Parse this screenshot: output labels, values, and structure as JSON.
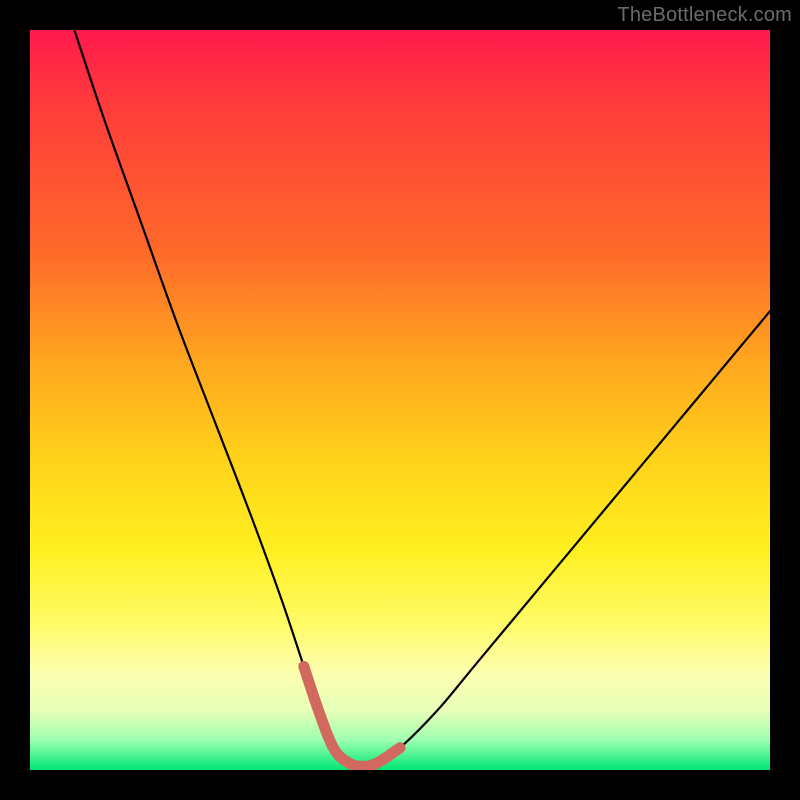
{
  "watermark": {
    "text": "TheBottleneck.com"
  },
  "colors": {
    "frame": "#000000",
    "curve_stroke": "#000000",
    "highlight_stroke": "#d2695e",
    "gradient_stops": [
      "#ff1a4d",
      "#ff3b3b",
      "#ff6a2a",
      "#ffa71f",
      "#ffd21a",
      "#ffef1f",
      "#fffb66",
      "#fdffb0",
      "#e7ffb8",
      "#9bffb0",
      "#00e676"
    ]
  },
  "chart_data": {
    "type": "line",
    "title": "",
    "xlabel": "",
    "ylabel": "",
    "xlim": [
      0,
      100
    ],
    "ylim": [
      0,
      100
    ],
    "series": [
      {
        "name": "bottleneck-curve",
        "x": [
          6,
          10,
          15,
          20,
          25,
          30,
          34,
          37,
          39,
          41,
          43,
          45,
          47,
          50,
          55,
          60,
          65,
          70,
          75,
          80,
          85,
          90,
          95,
          100
        ],
        "values": [
          100,
          88,
          74,
          60,
          47,
          34,
          23,
          14,
          8,
          3,
          1,
          0.5,
          1,
          3,
          8,
          14,
          20,
          26,
          32,
          38,
          44,
          50,
          56,
          62
        ]
      },
      {
        "name": "highlight-bottom",
        "x": [
          37,
          39,
          41,
          43,
          45,
          47,
          50
        ],
        "values": [
          14,
          8,
          3,
          1,
          0.5,
          1,
          3
        ]
      }
    ],
    "annotations": []
  }
}
